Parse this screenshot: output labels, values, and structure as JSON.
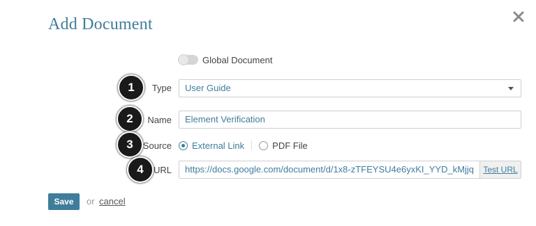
{
  "dialog": {
    "title": "Add Document",
    "close_icon": "close-icon"
  },
  "global_toggle": {
    "label": "Global Document",
    "on": false
  },
  "form": {
    "type": {
      "label": "Type",
      "value": "User Guide",
      "badge": "1"
    },
    "name": {
      "label": "Name",
      "value": "Element Verification",
      "badge": "2"
    },
    "source": {
      "label": "Source",
      "badge": "3",
      "options": [
        {
          "label": "External Link",
          "checked": true
        },
        {
          "label": "PDF File",
          "checked": false
        }
      ]
    },
    "url": {
      "label": "URL",
      "value": "https://docs.google.com/document/d/1x8-zTFEYSU4e6yxKI_YYD_kMjjq",
      "badge": "4",
      "test_label": "Test URL"
    }
  },
  "footer": {
    "save_label": "Save",
    "or_text": "or",
    "cancel_label": "cancel"
  },
  "colors": {
    "accent": "#3f7d9b",
    "badge": "#1a1a1a"
  }
}
